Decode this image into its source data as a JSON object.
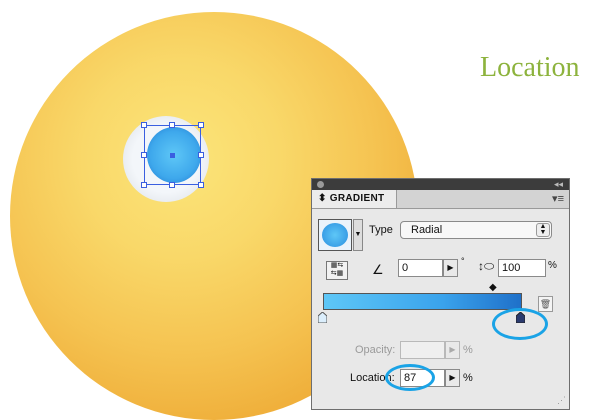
{
  "heading": "Location",
  "colors": {
    "heading": "#8db33d",
    "ring": "#1aa3e6",
    "gradient_start": "#5ec7f7",
    "gradient_end": "#1f70c9",
    "sphere_light": "#fbe57a",
    "sphere_dark": "#e99a28"
  },
  "panel": {
    "tab_label": "GRADIENT",
    "tab_icon": "expand-collapse-icon",
    "menu_icon": "panel-menu-icon",
    "type_label": "Type",
    "type_value": "Radial",
    "angle_value": "0",
    "angle_unit": "°",
    "aspect_value": "100",
    "aspect_unit": "%",
    "opacity_label": "Opacity:",
    "opacity_value": "",
    "opacity_unit": "%",
    "location_label": "Location:",
    "location_value": "87",
    "location_unit": "%"
  }
}
